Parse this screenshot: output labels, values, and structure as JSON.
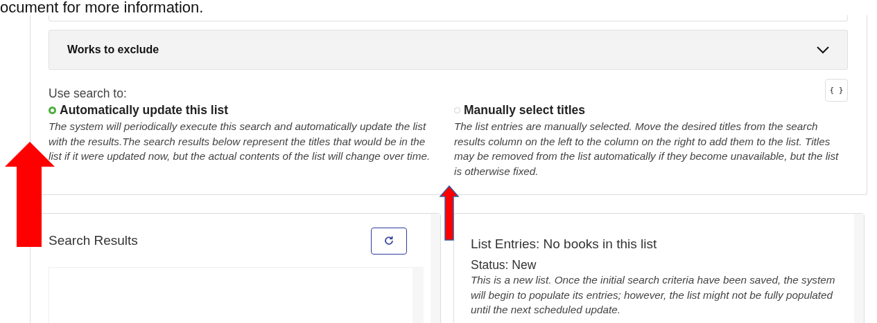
{
  "header_text": "ocument for more information.",
  "accordion": {
    "title": "Works to exclude",
    "expanded": false
  },
  "use_search_label": "Use search to:",
  "json_button": "{ }",
  "options": [
    {
      "label": "Automatically update this list",
      "selected": true,
      "description": "The system will periodically execute this search and automatically update the list with the results.The search results below represent the titles that would be in the list if it were updated now, but the actual contents of the list will change over time."
    },
    {
      "label": "Manually select titles",
      "selected": false,
      "description": "The list entries are manually selected. Move the desired titles from the search results column on the left to the column on the right to add them to the list. Titles may be removed from the list automatically if they become unavailable, but the list is otherwise fixed."
    }
  ],
  "search_results": {
    "title": "Search Results"
  },
  "list_entries": {
    "title": "List Entries: No books in this list",
    "status": "Status: New",
    "description": "This is a new list. Once the initial search criteria have been saved, the system will begin to populate its entries; however, the list might not be fully populated until the next scheduled update."
  }
}
